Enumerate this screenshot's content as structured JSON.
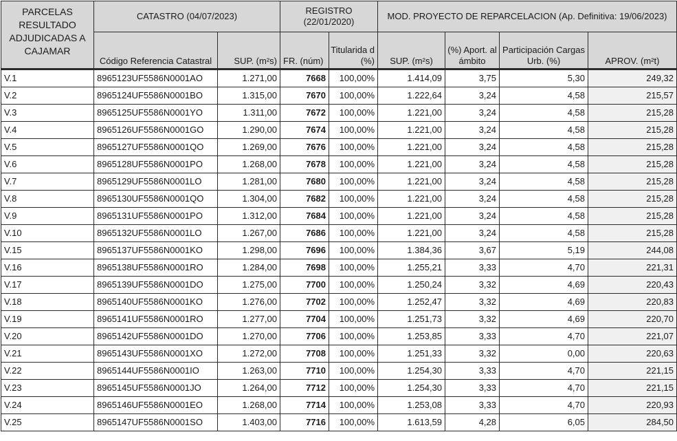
{
  "header": {
    "parcelas": "PARCELAS RESULTADO ADJUDICADAS A CAJAMAR",
    "catastro": "CATASTRO (04/07/2023)",
    "registro": "REGISTRO (22/01/2020)",
    "mod": "MOD. PROYECTO DE REPARCELACION (Ap. Definitiva: 19/06/2023)",
    "codigo": "Código Referencia Catastral",
    "sup_cat": "SUP. (m²s)",
    "fr": "FR. (núm)",
    "tit": "Titularida d (%)",
    "sup_mod": "SUP. (m²s)",
    "aport": "(%) Aport. al ámbito",
    "particip": "Participación Cargas Urb. (%)",
    "aprov": "APROV. (m²t)"
  },
  "rows": [
    [
      "V.1",
      "8965123UF5586N0001AO",
      "1.271,00",
      "7668",
      "100,00%",
      "1.414,09",
      "3,75",
      "5,30",
      "249,32"
    ],
    [
      "V.2",
      "8965124UF5586N0001BO",
      "1.315,00",
      "7670",
      "100,00%",
      "1.222,64",
      "3,24",
      "4,58",
      "215,57"
    ],
    [
      "V.3",
      "8965125UF5586N0001YO",
      "1.311,00",
      "7672",
      "100,00%",
      "1.221,00",
      "3,24",
      "4,58",
      "215,28"
    ],
    [
      "V.4",
      "8965126UF5586N0001GO",
      "1.290,00",
      "7674",
      "100,00%",
      "1.221,00",
      "3,24",
      "4,58",
      "215,28"
    ],
    [
      "V.5",
      "8965127UF5586N0001QO",
      "1.269,00",
      "7676",
      "100,00%",
      "1.221,00",
      "3,24",
      "4,58",
      "215,28"
    ],
    [
      "V.6",
      "8965128UF5586N0001PO",
      "1.268,00",
      "7678",
      "100,00%",
      "1.221,00",
      "3,24",
      "4,58",
      "215,28"
    ],
    [
      "V.7",
      "8965129UF5586N0001LO",
      "1.281,00",
      "7680",
      "100,00%",
      "1.221,00",
      "3,24",
      "4,58",
      "215,28"
    ],
    [
      "V.8",
      "8965130UF5586N0001QO",
      "1.304,00",
      "7682",
      "100,00%",
      "1.221,00",
      "3,24",
      "4,58",
      "215,28"
    ],
    [
      "V.9",
      "8965131UF5586N0001PO",
      "1.312,00",
      "7684",
      "100,00%",
      "1.221,00",
      "3,24",
      "4,58",
      "215,28"
    ],
    [
      "V.10",
      "8965132UF5586N0001LO",
      "1.267,00",
      "7686",
      "100,00%",
      "1.221,00",
      "3,24",
      "4,58",
      "215,28"
    ],
    [
      "V.15",
      "8965137UF5586N0001KO",
      "1.298,00",
      "7696",
      "100,00%",
      "1.384,36",
      "3,67",
      "5,19",
      "244,08"
    ],
    [
      "V.16",
      "8965138UF5586N0001RO",
      "1.284,00",
      "7698",
      "100,00%",
      "1.255,21",
      "3,33",
      "4,70",
      "221,31"
    ],
    [
      "V.17",
      "8965139UF5586N0001DO",
      "1.275,00",
      "7700",
      "100,00%",
      "1.250,24",
      "3,32",
      "4,69",
      "220,43"
    ],
    [
      "V.18",
      "8965140UF5586N0001KO",
      "1.276,00",
      "7702",
      "100,00%",
      "1.252,47",
      "3,32",
      "4,69",
      "220,83"
    ],
    [
      "V.19",
      "8965141UF5586N0001RO",
      "1.277,00",
      "7704",
      "100,00%",
      "1.251,73",
      "3,32",
      "4,69",
      "220,70"
    ],
    [
      "V.20",
      "8965142UF5586N0001DO",
      "1.270,00",
      "7706",
      "100,00%",
      "1.253,85",
      "3,33",
      "4,70",
      "221,07"
    ],
    [
      "V.21",
      "8965143UF5586N0001XO",
      "1.272,00",
      "7708",
      "100,00%",
      "1.251,33",
      "3,32",
      "0,00",
      "220,63"
    ],
    [
      "V.22",
      "8965144UF5586N0001IO",
      "1.263,00",
      "7710",
      "100,00%",
      "1.254,30",
      "3,33",
      "4,70",
      "221,15"
    ],
    [
      "V.23",
      "8965145UF5586N0001JO",
      "1.264,00",
      "7712",
      "100,00%",
      "1.254,30",
      "3,33",
      "4,70",
      "221,15"
    ],
    [
      "V.24",
      "8965146UF5586N0001EO",
      "1.268,00",
      "7714",
      "100,00%",
      "1.253,08",
      "3,33",
      "4,70",
      "220,93"
    ],
    [
      "V.25",
      "8965147UF5586N0001SO",
      "1.403,00",
      "7716",
      "100,00%",
      "1.613,59",
      "4,28",
      "6,05",
      "284,50"
    ]
  ]
}
